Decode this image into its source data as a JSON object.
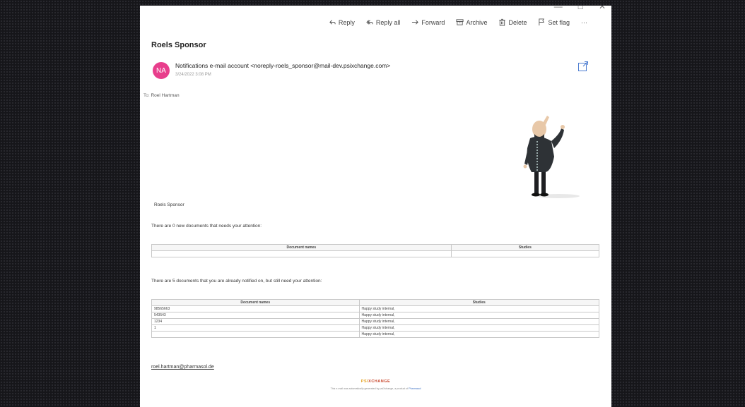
{
  "toolbar": {
    "reply": "Reply",
    "reply_all": "Reply all",
    "forward": "Forward",
    "archive": "Archive",
    "delete": "Delete",
    "set_flag": "Set flag",
    "more": "···"
  },
  "email": {
    "subject": "Roels Sponsor",
    "avatar_initials": "NA",
    "avatar_color": "#e83e8c",
    "sender": "Notifications e-mail account <noreply-roels_sponsor@mail-dev.psixchange.com>",
    "date": "3/24/2022 3:08 PM",
    "to_label": "To:",
    "to_name": "Roel Hartman"
  },
  "body": {
    "greeting": "Roels Sponsor",
    "new_docs_text": "There are 0 new documents that needs your attention:",
    "notified_text": "There are 5 documents that you are already notified on, but still need your attention:",
    "col_doc": "Document names",
    "col_studies": "Studies",
    "new_rows": [
      {
        "doc": "",
        "study": ""
      }
    ],
    "notified_rows": [
      {
        "doc": "98565663",
        "study": "Happy study internal,"
      },
      {
        "doc": "543543",
        "study": "Happy study internal,"
      },
      {
        "doc": "1234",
        "study": "Happy study internal,"
      },
      {
        "doc": "1",
        "study": "Happy study internal,"
      },
      {
        "doc": "",
        "study": "Happy study internal,"
      }
    ],
    "email_link": "roel.hartman@pharmasol.de"
  },
  "footer": {
    "logo_part1": "PSI",
    "logo_part2": "XCHANGE",
    "note": "This e-mail was automatically generated by psiXchange, a product of",
    "note_link": "Pharmasol"
  }
}
